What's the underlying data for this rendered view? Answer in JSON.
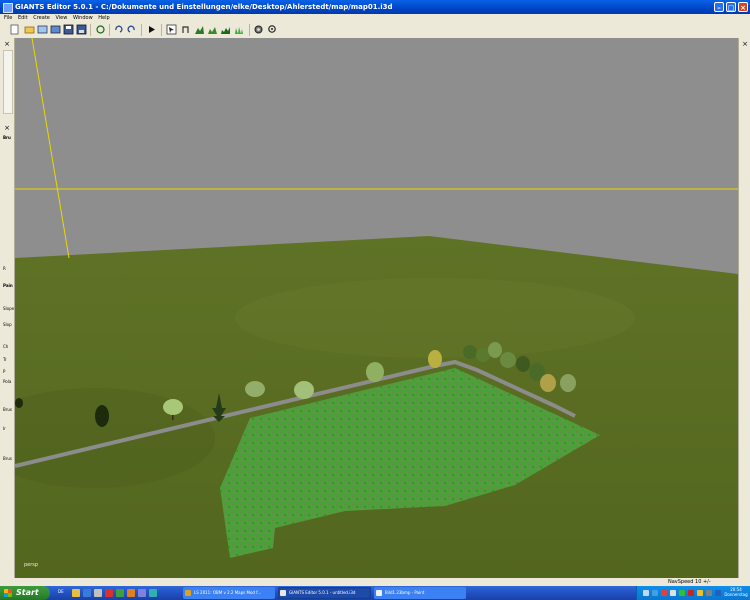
{
  "window": {
    "title": "GIANTS Editor 5.0.1 - C:/Dokumente und Einstellungen/elke/Desktop/Ahlerstedt/map/map01.i3d"
  },
  "menu": [
    "File",
    "Edit",
    "Create",
    "View",
    "Window",
    "Help"
  ],
  "toolbar": {
    "icons": [
      "new-icon",
      "open-icon",
      "import-icon",
      "export-icon",
      "save-icon",
      "save-as-icon",
      "refresh-icon",
      "undo-icon",
      "redo-icon",
      "play-icon",
      "select-icon",
      "move-icon",
      "terrain-sculpt-icon",
      "terrain-paint-icon",
      "foliage-paint-icon",
      "grass-icon",
      "settings-icon",
      "zoom-icon"
    ]
  },
  "left_panel": {
    "labels": [
      "Bru",
      "R",
      "Pain",
      "Slope",
      "Slop",
      "Ch",
      "Tr",
      "P",
      "Pola",
      "Brus",
      "Ir",
      "Brus"
    ]
  },
  "viewport": {
    "camera_label": "persp",
    "colors": {
      "sky": "#8e8e8e",
      "terrain": "#5a6e24",
      "road": "#8c8c8c",
      "painted_field": "#4ea83a",
      "guide_line": "#e8d800"
    }
  },
  "status": {
    "nav_speed": "NavSpeed 10 +/-"
  },
  "taskbar": {
    "start_label": "Start",
    "language": "DE",
    "tasks": [
      {
        "label": "LS 2011: OBM v 2.2 Maps Mod f...",
        "active": false
      },
      {
        "label": "GIANTS Editor 5.0.1 - untitled.i3d",
        "active": true
      },
      {
        "label": "Bild1.23bmp - Paint",
        "active": false
      }
    ],
    "clock_time": "20:54",
    "clock_day": "Donnerstag"
  }
}
